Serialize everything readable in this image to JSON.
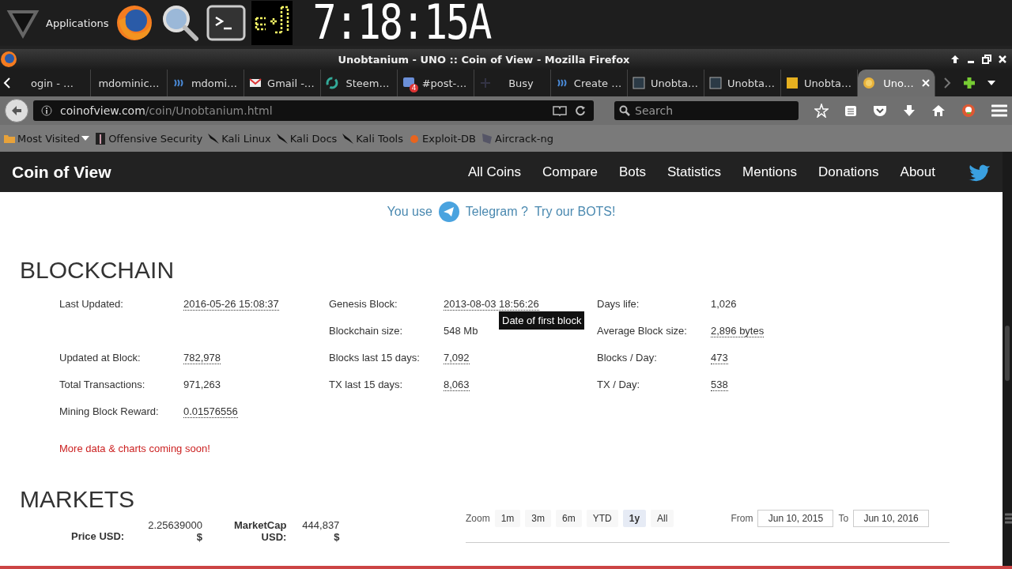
{
  "panel": {
    "menu_label": "Applications",
    "clock": "7:18:15A"
  },
  "window": {
    "title": "Unobtanium - UNO :: Coin of View - Mozilla Firefox"
  },
  "tabs": [
    {
      "label": "ogin - …",
      "selected": false
    },
    {
      "label": "mdominic…",
      "selected": false
    },
    {
      "label": "mdomi…",
      "selected": false
    },
    {
      "label": "Gmail -…",
      "selected": false
    },
    {
      "label": "Steem…",
      "selected": false
    },
    {
      "label": "#post-…",
      "badge": "4",
      "selected": false
    },
    {
      "label": "Busy",
      "selected": false
    },
    {
      "label": "Create …",
      "selected": false
    },
    {
      "label": "Unobta…",
      "selected": false
    },
    {
      "label": "Unobta…",
      "selected": false
    },
    {
      "label": "Unobta…",
      "selected": false
    },
    {
      "label": "Uno…",
      "selected": true
    }
  ],
  "address": {
    "host": "coinofview.com",
    "path": "/coin/Unobtanium.html"
  },
  "search": {
    "placeholder": "Search"
  },
  "bookmarks": [
    {
      "label": "Most Visited",
      "dropdown": true
    },
    {
      "label": "Offensive Security",
      "dropdown": false
    },
    {
      "label": "Kali Linux",
      "dropdown": false
    },
    {
      "label": "Kali Docs",
      "dropdown": false
    },
    {
      "label": "Kali Tools",
      "dropdown": false
    },
    {
      "label": "Exploit-DB",
      "dropdown": false
    },
    {
      "label": "Aircrack-ng",
      "dropdown": false
    }
  ],
  "site": {
    "brand": "Coin of View",
    "nav": [
      "All Coins",
      "Compare",
      "Bots",
      "Statistics",
      "Mentions",
      "Donations",
      "About"
    ]
  },
  "banner": {
    "lead": "You use",
    "app": "Telegram ?",
    "link": "Try our BOTS!"
  },
  "blockchain": {
    "heading": "BLOCKCHAIN",
    "rows": [
      {
        "cells": [
          {
            "kind": "pair",
            "label": "Last Updated:",
            "value": "2016-05-26 15:08:37",
            "dotted": true
          },
          {
            "kind": "pair",
            "label": "Genesis Block:",
            "value": "2013-08-03 18:56:26",
            "dotted": true
          },
          {
            "kind": "pair",
            "label": "Days life:",
            "value": "1,026",
            "dotted": false
          }
        ]
      },
      {
        "cells": [
          {
            "kind": "blank"
          },
          {
            "kind": "pair",
            "label": "Blockchain size:",
            "value": "548 Mb",
            "dotted": false
          },
          {
            "kind": "pair",
            "label": "Average Block size:",
            "value": "2,896 bytes",
            "dotted": true
          }
        ]
      },
      {
        "cells": [
          {
            "kind": "pair",
            "label": "Updated at Block:",
            "value": "782,978",
            "dotted": true
          },
          {
            "kind": "pair",
            "label": "Blocks last 15 days:",
            "value": "7,092",
            "dotted": true
          },
          {
            "kind": "pair",
            "label": "Blocks / Day:",
            "value": "473",
            "dotted": true
          }
        ]
      },
      {
        "cells": [
          {
            "kind": "pair",
            "label": "Total Transactions:",
            "value": "971,263",
            "dotted": false
          },
          {
            "kind": "pair",
            "label": "TX last 15 days:",
            "value": "8,063",
            "dotted": true
          },
          {
            "kind": "pair",
            "label": "TX / Day:",
            "value": "538",
            "dotted": true
          }
        ]
      },
      {
        "cells": [
          {
            "kind": "pair",
            "label": "Mining Block Reward:",
            "value": "0.01576556",
            "dotted": true
          },
          {
            "kind": "blank"
          },
          {
            "kind": "blank"
          }
        ]
      }
    ],
    "tooltip": "Date of first block",
    "note": "More data & charts coming soon!"
  },
  "markets": {
    "heading": "MARKETS",
    "price": {
      "label": "Price USD:",
      "value": "2.25639000",
      "unit": "$"
    },
    "marketcap": {
      "label": "MarketCap",
      "label_2": "USD:",
      "value": "444,837",
      "unit": "$"
    },
    "zoom_label": "Zoom",
    "ranges": [
      {
        "label": "1m",
        "selected": false
      },
      {
        "label": "3m",
        "selected": false
      },
      {
        "label": "6m",
        "selected": false
      },
      {
        "label": "YTD",
        "selected": false
      },
      {
        "label": "1y",
        "selected": true
      },
      {
        "label": "All",
        "selected": false
      }
    ],
    "from_label": "From",
    "from": "Jun 10, 2015",
    "to_label": "To",
    "to": "Jun 10, 2016"
  }
}
